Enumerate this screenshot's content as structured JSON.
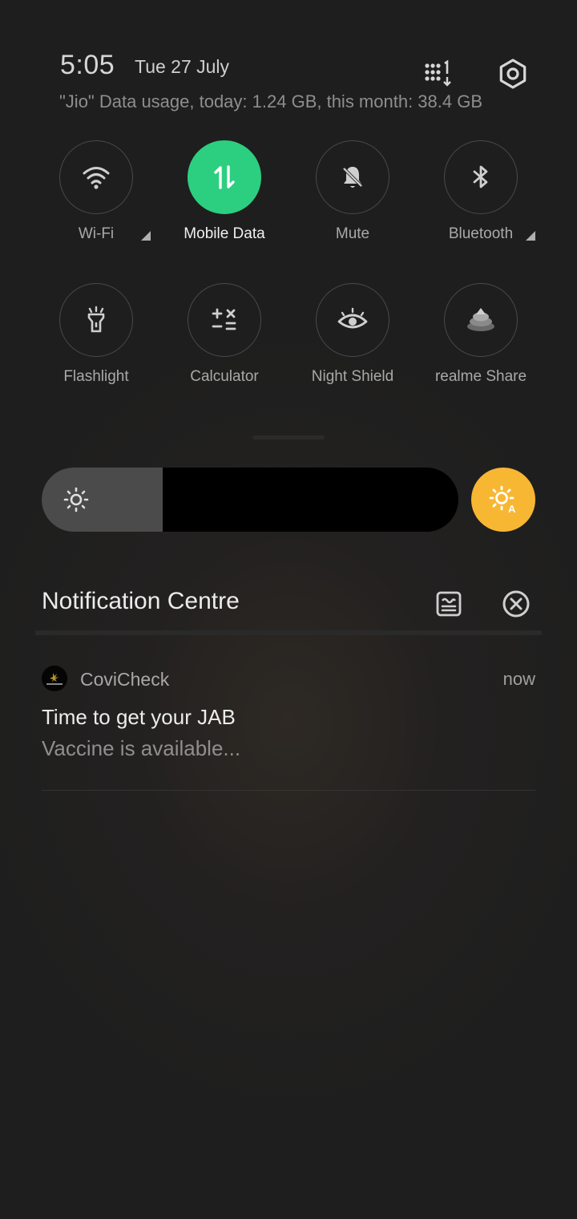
{
  "header": {
    "time": "5:05",
    "date": "Tue 27 July",
    "data_usage": "\"Jio\" Data usage, today: 1.24 GB, this month: 38.4 GB",
    "grid_icon": "dial-grid-icon",
    "settings_icon": "settings-icon"
  },
  "tiles": [
    {
      "label": "Wi-Fi",
      "icon": "wifi-icon",
      "active": false,
      "expandable": true
    },
    {
      "label": "Mobile Data",
      "icon": "mobile-data-icon",
      "active": true,
      "expandable": false
    },
    {
      "label": "Mute",
      "icon": "bell-off-icon",
      "active": false,
      "expandable": false
    },
    {
      "label": "Bluetooth",
      "icon": "bluetooth-icon",
      "active": false,
      "expandable": true
    },
    {
      "label": "Flashlight",
      "icon": "flashlight-icon",
      "active": false,
      "expandable": false
    },
    {
      "label": "Calculator",
      "icon": "calculator-icon",
      "active": false,
      "expandable": false
    },
    {
      "label": "Night Shield",
      "icon": "eye-icon",
      "active": false,
      "expandable": false
    },
    {
      "label": "realme Share",
      "icon": "realme-share-icon",
      "active": false,
      "expandable": false
    }
  ],
  "brightness": {
    "level": 0.29,
    "auto": true,
    "accent": "#f7b733"
  },
  "colors": {
    "active_tile": "#2ccf7f",
    "auto_brightness": "#f7b733"
  },
  "notification_centre": {
    "title": "Notification Centre",
    "manage_icon": "manage-notifications-icon",
    "clear_icon": "clear-all-icon"
  },
  "notifications": [
    {
      "app": "CoviCheck",
      "time": "now",
      "title": "Time to get your JAB",
      "body": "Vaccine is available..."
    }
  ]
}
